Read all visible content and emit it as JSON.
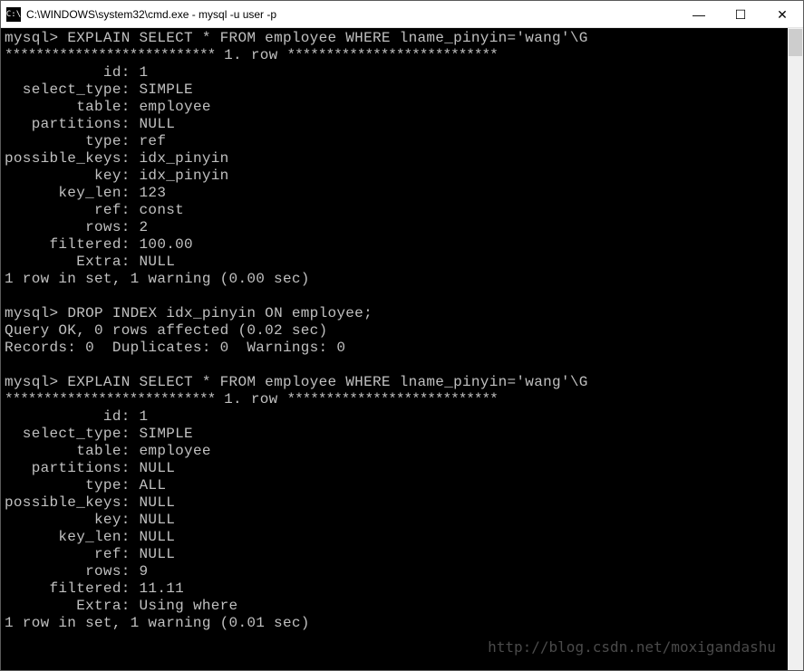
{
  "titlebar": {
    "icon_label": "C:\\",
    "title": "C:\\WINDOWS\\system32\\cmd.exe - mysql  -u user -p"
  },
  "window_controls": {
    "minimize": "—",
    "maximize": "☐",
    "close": "✕"
  },
  "terminal": {
    "prompt": "mysql>",
    "query1": "EXPLAIN SELECT * FROM employee WHERE lname_pinyin='wang'\\G",
    "row_header_stars_left": "***************************",
    "row_header_text": " 1. row ",
    "row_header_stars_right": "***************************",
    "explain1": {
      "id": "1",
      "select_type": "SIMPLE",
      "table": "employee",
      "partitions": "NULL",
      "type": "ref",
      "possible_keys": "idx_pinyin",
      "key": "idx_pinyin",
      "key_len": "123",
      "ref": "const",
      "rows": "2",
      "filtered": "100.00",
      "Extra": "NULL"
    },
    "result1": "1 row in set, 1 warning (0.00 sec)",
    "query2": "DROP INDEX idx_pinyin ON employee;",
    "drop_result1": "Query OK, 0 rows affected (0.02 sec)",
    "drop_result2": "Records: 0  Duplicates: 0  Warnings: 0",
    "query3": "EXPLAIN SELECT * FROM employee WHERE lname_pinyin='wang'\\G",
    "explain2": {
      "id": "1",
      "select_type": "SIMPLE",
      "table": "employee",
      "partitions": "NULL",
      "type": "ALL",
      "possible_keys": "NULL",
      "key": "NULL",
      "key_len": "NULL",
      "ref": "NULL",
      "rows": "9",
      "filtered": "11.11",
      "Extra": "Using where"
    },
    "result2": "1 row in set, 1 warning (0.01 sec)"
  },
  "watermark": "http://blog.csdn.net/moxigandashu"
}
